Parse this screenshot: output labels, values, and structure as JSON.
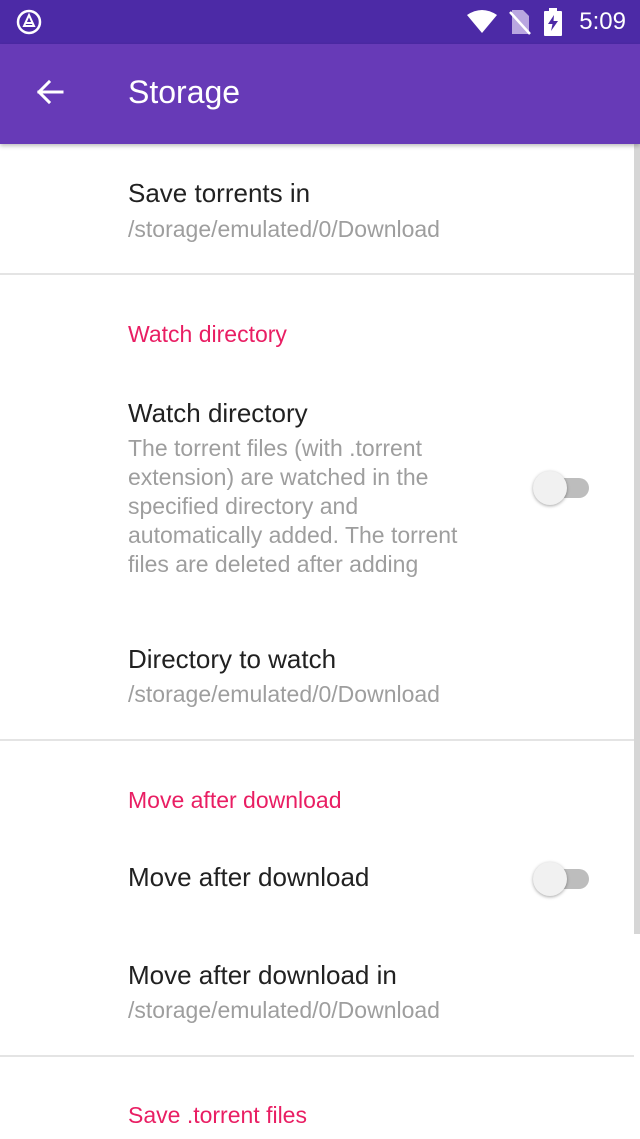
{
  "status_bar": {
    "time": "5:09",
    "left_icon": "app-notification-icon",
    "icons": [
      "wifi-icon",
      "no-sim-icon",
      "battery-charging-icon"
    ],
    "background": "#4c2aa6"
  },
  "app_bar": {
    "title": "Storage",
    "back_icon": "arrow-back-icon",
    "background": "#673ab7"
  },
  "accent_color": "#e91e63",
  "preferences": {
    "save_torrents_in": {
      "title": "Save torrents in",
      "summary": "/storage/emulated/0/Download"
    },
    "watch_directory_category": "Watch directory",
    "watch_directory": {
      "title": "Watch directory",
      "summary_lines": [
        "The torrent files (with .torrent",
        "extension) are watched in the",
        "specified directory and",
        "automatically added. The torrent",
        "files are deleted after adding"
      ],
      "enabled": false
    },
    "directory_to_watch": {
      "title": "Directory to watch",
      "summary": "/storage/emulated/0/Download"
    },
    "move_after_download_category": "Move after download",
    "move_after_download": {
      "title": "Move after download",
      "enabled": false
    },
    "move_after_download_in": {
      "title": "Move after download in",
      "summary": "/storage/emulated/0/Download"
    },
    "save_torrent_files_category": "Save .torrent files"
  }
}
